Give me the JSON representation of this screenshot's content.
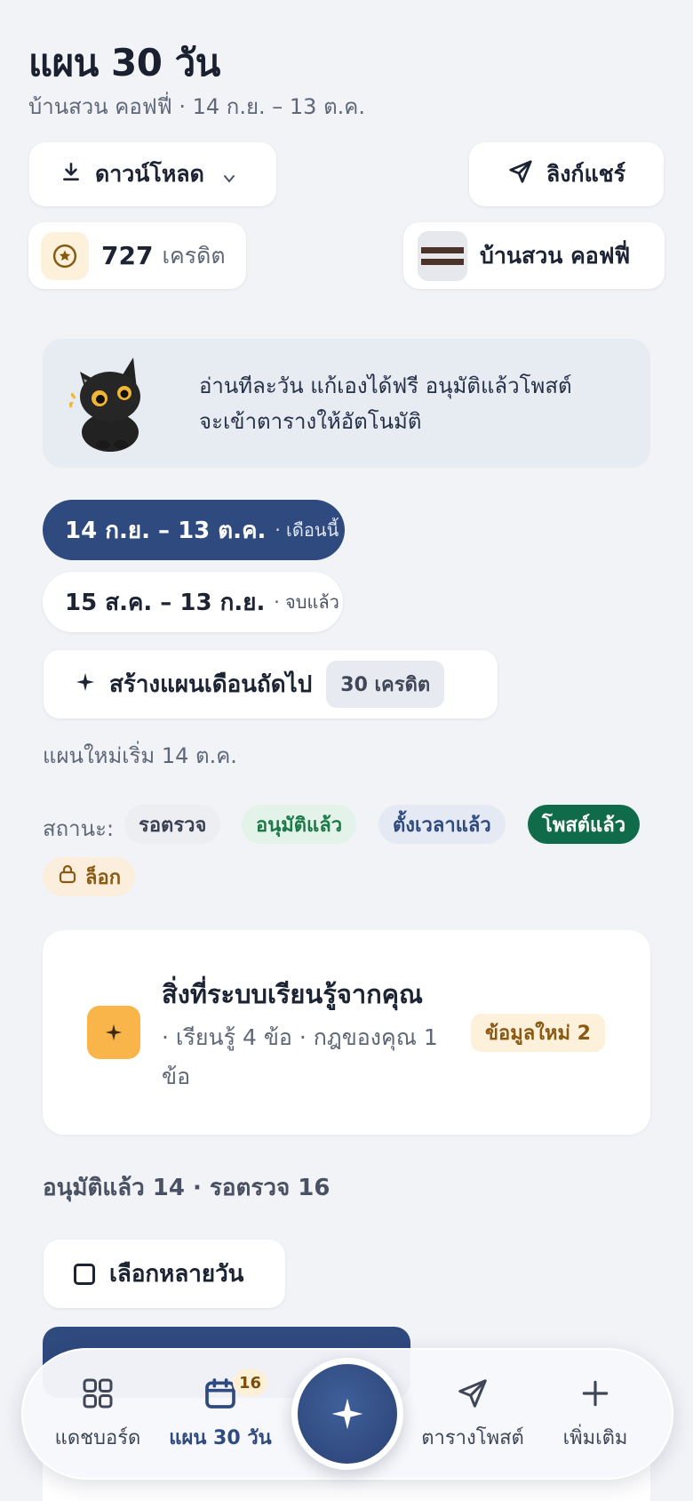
{
  "header": {
    "title": "แผน 30 วัน",
    "subtitle": "บ้านสวน คอฟฟี่ · 14 ก.ย. – 13 ต.ค."
  },
  "toolbar": {
    "download_label": "ดาวน์โหลด",
    "share_label": "ลิงก์แชร์"
  },
  "credits": {
    "amount": "727",
    "unit": "เครดิต"
  },
  "brand": {
    "name": "บ้านสวน คอฟฟี่"
  },
  "tip": {
    "line1": "อ่านทีละวัน แก้เองได้ฟรี อนุมัติแล้วโพสต์",
    "line2": "จะเข้าตารางให้อัตโนมัติ"
  },
  "periods": [
    {
      "range": "14 ก.ย. – 13 ต.ค.",
      "tag": "· เดือนนี้"
    },
    {
      "range": "15 ส.ค. – 13 ก.ย.",
      "tag": "· จบแล้ว"
    }
  ],
  "next_plan": {
    "label": "สร้างแผนเดือนถัดไป",
    "cost": "30 เครดิต",
    "note": "แผนใหม่เริ่ม 14 ต.ค."
  },
  "status": {
    "label": "สถานะ:",
    "chips": [
      "รอตรวจ",
      "อนุมัติแล้ว",
      "ตั้งเวลาแล้ว",
      "โพสต์แล้ว",
      "ล็อก"
    ]
  },
  "learning": {
    "title": "สิ่งที่ระบบเรียนรู้จากคุณ",
    "desc": "· เรียนรู้ 4 ข้อ · กฎของคุณ 1 ข้อ",
    "badge": "ข้อมูลใหม่ 2"
  },
  "summary": "อนุมัติแล้ว 14 · รอตรวจ 16",
  "multi_select_label": "เลือกหลายวัน",
  "nav": {
    "dashboard": "แดชบอร์ด",
    "plan": "แผน 30 วัน",
    "plan_badge": "16",
    "schedule": "ตารางโพสต์",
    "more": "เพิ่มเติม"
  },
  "colors": {
    "primary": "#2f4a7f",
    "background": "#f1f3f7",
    "posted": "#0f6b4a",
    "accent": "#f9b54a"
  },
  "icons": [
    "download-icon",
    "chevron-down-icon",
    "send-icon",
    "coin-icon",
    "sparkle-icon",
    "lock-icon",
    "checkbox-icon",
    "grid-icon",
    "calendar-icon",
    "plus-icon"
  ]
}
